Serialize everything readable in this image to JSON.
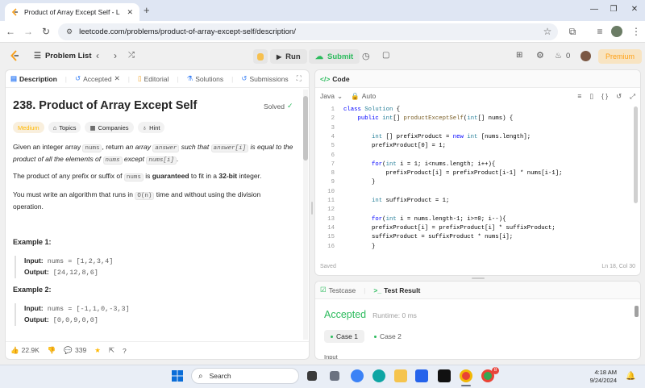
{
  "browser": {
    "tab_title": "Product of Array Except Self - L",
    "url": "leetcode.com/problems/product-of-array-except-self/description/"
  },
  "header": {
    "problem_list": "Problem List",
    "run": "Run",
    "submit": "Submit",
    "streak": "0",
    "premium": "Premium"
  },
  "left_tabs": {
    "description": "Description",
    "accepted": "Accepted",
    "editorial": "Editorial",
    "solutions": "Solutions",
    "submissions": "Submissions"
  },
  "problem": {
    "title": "238. Product of Array Except Self",
    "status": "Solved",
    "difficulty": "Medium",
    "topics": "Topics",
    "companies": "Companies",
    "hint": "Hint",
    "p1_a": "Given an integer array ",
    "p1_nums": "nums",
    "p1_b": ", return ",
    "p1_c": "an array ",
    "p1_answer": "answer",
    "p1_d": " such that ",
    "p1_answeri": "answer[i]",
    "p1_e": " is equal to the product of all the elements of ",
    "p1_nums2": "nums",
    "p1_f": " except ",
    "p1_numsi": "nums[i]",
    "p1_g": ".",
    "p2_a": "The product of any prefix or suffix of ",
    "p2_nums": "nums",
    "p2_b": " is ",
    "p2_guaranteed": "guaranteed",
    "p2_c": " to fit in a ",
    "p2_bit": "32-bit",
    "p2_d": " integer.",
    "p3_a": "You must write an algorithm that runs in ",
    "p3_on": "O(n)",
    "p3_b": " time and without using the division operation.",
    "ex1_title": "Example 1:",
    "ex2_title": "Example 2:",
    "input_label": "Input:",
    "output_label": "Output:",
    "ex1_input": "nums = [1,2,3,4]",
    "ex1_output": "[24,12,8,6]",
    "ex2_input": "nums = [-1,1,0,-3,3]",
    "ex2_output": "[0,0,9,0,0]"
  },
  "footer": {
    "likes": "22.9K",
    "comments": "339"
  },
  "code_panel": {
    "title": "Code",
    "language": "Java",
    "auto": "Auto",
    "saved": "Saved",
    "cursor": "Ln 18, Col 30",
    "lines": [
      {
        "n": "1",
        "text": "class Solution {"
      },
      {
        "n": "2",
        "text": "    public int[] productExceptSelf(int[] nums) {"
      },
      {
        "n": "3",
        "text": ""
      },
      {
        "n": "4",
        "text": "        int [] prefixProduct = new int [nums.length];"
      },
      {
        "n": "5",
        "text": "        prefixProduct[0] = 1;"
      },
      {
        "n": "6",
        "text": ""
      },
      {
        "n": "7",
        "text": "        for(int i = 1; i<nums.length; i++){"
      },
      {
        "n": "8",
        "text": "            prefixProduct[i] = prefixProduct[i-1] * nums[i-1];"
      },
      {
        "n": "9",
        "text": "        }"
      },
      {
        "n": "10",
        "text": ""
      },
      {
        "n": "11",
        "text": "        int suffixProduct = 1;"
      },
      {
        "n": "12",
        "text": ""
      },
      {
        "n": "13",
        "text": "        for(int i = nums.length-1; i>=0; i--){"
      },
      {
        "n": "14",
        "text": "        prefixProduct[i] = prefixProduct[i] * suffixProduct;"
      },
      {
        "n": "15",
        "text": "        suffixProduct = suffixProduct * nums[i];"
      },
      {
        "n": "16",
        "text": "        }"
      }
    ]
  },
  "result_panel": {
    "testcase": "Testcase",
    "test_result": "Test Result",
    "status": "Accepted",
    "runtime": "Runtime: 0 ms",
    "case1": "Case 1",
    "case2": "Case 2",
    "input": "Input"
  },
  "taskbar": {
    "search": "Search",
    "time": "4:18 AM",
    "date": "9/24/2024",
    "badge": "8"
  },
  "colors": {
    "accent": "#ffa116",
    "green": "#2cbb5d",
    "code_keyword": "#0000ff",
    "code_type": "#267f99",
    "code_fn": "#795e26"
  }
}
